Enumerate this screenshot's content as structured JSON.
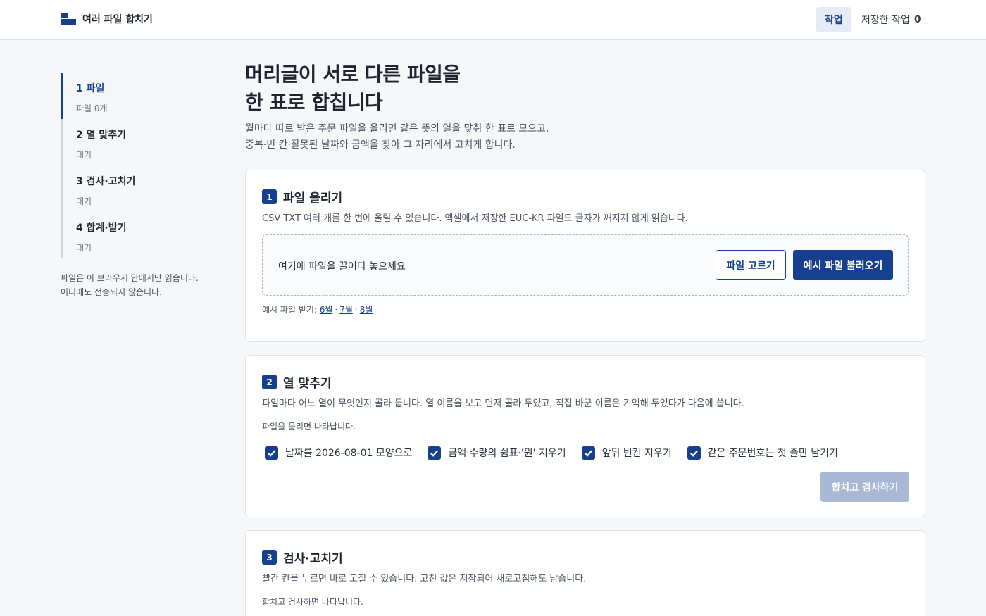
{
  "header": {
    "app_title": "여러 파일 합치기",
    "nav_work": "작업",
    "nav_saved": "저장한 작업",
    "saved_count": "0"
  },
  "sidebar": {
    "steps": [
      {
        "label": "1 파일",
        "status": "파일 0개"
      },
      {
        "label": "2 열 맞추기",
        "status": "대기"
      },
      {
        "label": "3 검사·고치기",
        "status": "대기"
      },
      {
        "label": "4 합계·받기",
        "status": "대기"
      }
    ],
    "privacy_line1": "파일은 이 브라우저 안에서만 읽습니다.",
    "privacy_line2": "어디에도 전송되지 않습니다."
  },
  "main": {
    "title_line1": "머리글이 서로 다른 파일을",
    "title_line2": "한 표로 합칩니다",
    "desc_line1": "월마다 따로 받은 주문 파일을 올리면 같은 뜻의 열을 맞춰 한 표로 모으고,",
    "desc_line2": "중복·빈 칸·잘못된 날짜와 금액을 찾아 그 자리에서 고치게 합니다."
  },
  "upload": {
    "num": "1",
    "title": "파일 올리기",
    "desc": "CSV·TXT 여러 개를 한 번에 올릴 수 있습니다. 엑셀에서 저장한 EUC-KR 파일도 글자가 깨지지 않게 읽습니다.",
    "drop_text": "여기에 파일을 끌어다 놓으세요",
    "choose_button": "파일 고르기",
    "sample_button": "예시 파일 불러오기",
    "samples_label": "예시 파일 받기:",
    "sample_links": [
      "6월",
      "7월",
      "8월"
    ]
  },
  "mapping": {
    "num": "2",
    "title": "열 맞추기",
    "desc": "파일마다 어느 열이 무엇인지 골라 둡니다. 열 이름을 보고 먼저 골라 두었고, 직접 바꾼 이름은 기억해 두었다가 다음에 씁니다.",
    "hint": "파일을 올리면 나타납니다.",
    "options": [
      {
        "label": "날짜를 2026-08-01 모양으로",
        "checked": true
      },
      {
        "label": "금액·수량의 쉼표·'원' 지우기",
        "checked": true
      },
      {
        "label": "앞뒤 빈칸 지우기",
        "checked": true
      },
      {
        "label": "같은 주문번호는 첫 줄만 남기기",
        "checked": true
      }
    ],
    "merge_button": "합치고 검사하기"
  },
  "review": {
    "num": "3",
    "title": "검사·고치기",
    "desc": "빨간 칸을 누르면 바로 고칠 수 있습니다. 고친 값은 저장되어 새로고침해도 남습니다.",
    "hint": "합치고 검사하면 나타납니다."
  },
  "colors": {
    "accent": "#173f8f",
    "disabled": "#a9b8d4",
    "background": "#f6f7f9"
  }
}
